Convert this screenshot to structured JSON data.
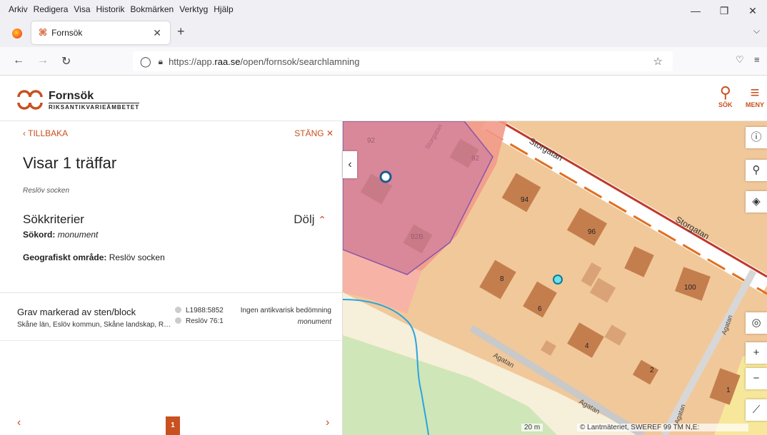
{
  "browser": {
    "menu": [
      "Arkiv",
      "Redigera",
      "Visa",
      "Historik",
      "Bokmärken",
      "Verktyg",
      "Hjälp"
    ],
    "tab_title": "Fornsök",
    "url_prefix": "https://app.",
    "url_host": "raa.se",
    "url_path": "/open/fornsok/searchlamning"
  },
  "app": {
    "logo_title": "Fornsök",
    "logo_subtitle": "RIKSANTIKVARIEÄMBETET",
    "search_label": "SÖK",
    "menu_label": "MENY"
  },
  "panel": {
    "back_label": "‹ TILLBAKA",
    "close_label": "STÄNG ✕",
    "hits_title": "Visar 1 träffar",
    "parish": "Reslöv socken",
    "criteria_label": "Sökkriterier",
    "hide_label": "Dölj",
    "keyword_label": "Sökord:",
    "keyword_value": "monument",
    "geo_label": "Geografiskt område:",
    "geo_value": "Reslöv socken"
  },
  "results": [
    {
      "title": "Grav markerad av sten/block",
      "location": "Skåne län, Eslöv kommun, Skåne landskap, R…",
      "id1": "L1988:5852",
      "id2": "Reslöv 76:1",
      "status": "Ingen antikvarisk bedömning",
      "keyword": "monument"
    }
  ],
  "pager": {
    "current": "1"
  },
  "map": {
    "street_labels": [
      "Storgatan",
      "Storgatan",
      "Storgatan",
      "Agatan",
      "Agatan",
      "Agatan",
      "Agatan"
    ],
    "house_numbers": [
      "94",
      "96",
      "100",
      "8",
      "6",
      "4",
      "2",
      "1",
      "92",
      "92B",
      "92"
    ],
    "scale": "20 m",
    "attribution": "© Lantmäteriet, SWEREF 99 TM N,E:"
  },
  "colors": {
    "accent": "#c8511f",
    "pink_area": "#d9889a",
    "red_area": "#f29a8a",
    "ground": "#f1c89a",
    "building": "#c47e4e"
  }
}
